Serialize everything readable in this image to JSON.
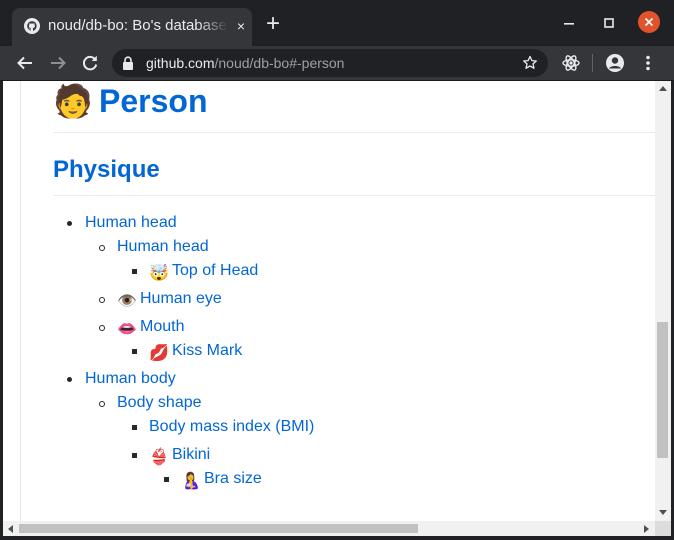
{
  "browser": {
    "tab_title": "noud/db-bo: Bo's database",
    "tab_close_icon": "×",
    "new_tab_icon": "+",
    "url_host": "github.com",
    "url_path": "/noud/db-bo#-person",
    "icons": [
      "github-icon",
      "back-icon",
      "forward-icon",
      "reload-icon",
      "lock-icon",
      "star-icon",
      "extension-icon",
      "profile-icon",
      "menu-icon",
      "minimize-icon",
      "maximize-icon",
      "close-icon"
    ],
    "close_color": "#e0532f"
  },
  "page": {
    "h1_emoji": "🧑",
    "h1_text": "Person",
    "h2_text": "Physique",
    "link_color": "#0366d6",
    "tree": {
      "human_head": "Human head",
      "human_head_sub": "Human head",
      "top_of_head_emoji": "🤯",
      "top_of_head": "Top of Head",
      "human_eye_emoji": "👁️",
      "human_eye": "Human eye",
      "mouth_emoji": "👄",
      "mouth": "Mouth",
      "kiss_mark_emoji": "💋",
      "kiss_mark": "Kiss Mark",
      "human_body": "Human body",
      "body_shape": "Body shape",
      "bmi": "Body mass index (BMI)",
      "bikini_emoji": "👙",
      "bikini": "Bikini",
      "bra_size_emoji": "🤱",
      "bra_size": "Bra size"
    }
  }
}
